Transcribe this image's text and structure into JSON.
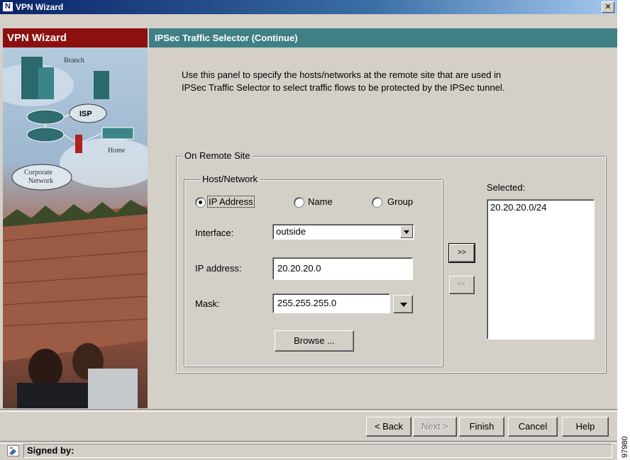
{
  "window": {
    "title": "VPN Wizard",
    "close_glyph": "✕",
    "app_icon": "N"
  },
  "left_panel": {
    "title": "VPN Wizard",
    "illustration_labels": {
      "branch": "Branch",
      "isp": "ISP",
      "home": "Home",
      "corporate": "Corporate",
      "network": "Network"
    }
  },
  "panel": {
    "title": "IPSec Traffic Selector (Continue)",
    "description_line1": "Use this panel to specify the hosts/networks at the remote site that are used in",
    "description_line2": "IPSec Traffic Selector to select traffic flows to be protected by the IPSec tunnel."
  },
  "remote_site": {
    "legend": "On Remote Site",
    "host_network": {
      "legend": "Host/Network",
      "options": [
        "IP Address",
        "Name",
        "Group"
      ],
      "selected": "IP Address",
      "interface_label": "Interface:",
      "interface_value": "outside",
      "ip_label": "IP address:",
      "ip_value": "20.20.20.0",
      "mask_label": "Mask:",
      "mask_value": "255.255.255.0",
      "browse_label": "Browse ..."
    },
    "add_label": ">>",
    "remove_label": "<<",
    "selected_label": "Selected:",
    "selected_items": [
      "20.20.20.0/24"
    ]
  },
  "footer": {
    "back_label": "< Back",
    "next_label": "Next >",
    "finish_label": "Finish",
    "cancel_label": "Cancel",
    "help_label": "Help"
  },
  "status": {
    "signed_by": "Signed by:"
  },
  "side_code": "97980"
}
